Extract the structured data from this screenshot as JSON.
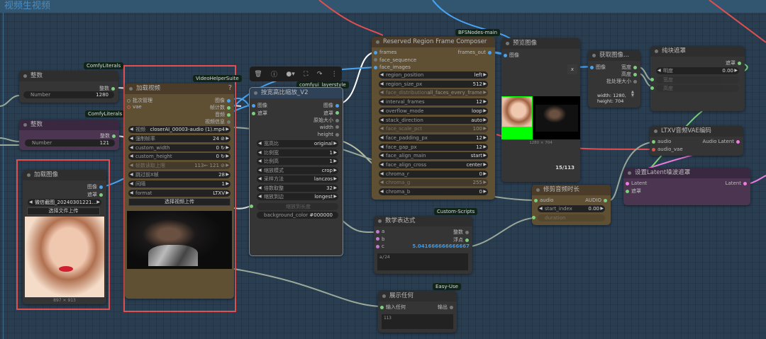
{
  "group_title": "视频生视频",
  "colors": {
    "canvas": "#2a3e52",
    "node": "#353535",
    "video_node": "#5f4f33",
    "purple_node": "#4b3550",
    "highlight": "#e05050"
  },
  "int1": {
    "tag": "ComfyLiterals",
    "title": "整数",
    "output": "整数",
    "widget_label": "Number",
    "widget_value": "1280"
  },
  "int2": {
    "tag": "ComfyLiterals",
    "title": "整数",
    "output": "整数",
    "widget_label": "Number",
    "widget_value": "121"
  },
  "load_image": {
    "title": "加载图像",
    "outputs": [
      "图像",
      "遮罩"
    ],
    "file": "微信截图_20240301221...",
    "upload": "选择文件上传",
    "size": "897 × 913"
  },
  "load_video": {
    "tag": "VideoHelperSuite",
    "title": "加载视频",
    "help": "?",
    "inputs": [
      "批次管理",
      "vae"
    ],
    "outputs": [
      "图像",
      "帧计数",
      "音频",
      "视频信息"
    ],
    "widgets": [
      {
        "l": "视频",
        "v": "closerAI_00003-audio (1).mp4"
      },
      {
        "l": "强制帧率",
        "v": "24 ⊘"
      },
      {
        "l": "custom_width",
        "v": "0 ↻"
      },
      {
        "l": "custom_height",
        "v": "0 ↻"
      },
      {
        "l": "帧数读取上限",
        "v": "113←  121 ⊘"
      },
      {
        "l": "跳过前X帧",
        "v": "28"
      },
      {
        "l": "间隔",
        "v": "1"
      },
      {
        "l": "format",
        "v": "LTXV"
      }
    ],
    "upload": "选择视频上传"
  },
  "toolbar": {
    "icons": [
      "trash-icon",
      "info-icon",
      "color-icon",
      "fit-icon",
      "bypass-icon",
      "more-icon"
    ]
  },
  "scale": {
    "tag": "comfyui_layerstyle",
    "title": "按宽高比缩放_V2",
    "inputs": [
      "图像",
      "遮罩"
    ],
    "outputs": [
      "图像",
      "遮罩",
      "原始大小",
      "width",
      "height"
    ],
    "widgets": [
      {
        "l": "宽高比",
        "v": "original"
      },
      {
        "l": "比例宽",
        "v": "1"
      },
      {
        "l": "比例高",
        "v": "1"
      },
      {
        "l": "缩放模式",
        "v": "crop"
      },
      {
        "l": "采样方法",
        "v": "lanczos"
      },
      {
        "l": "倍数取整",
        "v": "32"
      },
      {
        "l": "缩放到边",
        "v": "longest"
      }
    ],
    "to_length": "缩放到长度",
    "bg_label": "background_color",
    "bg_value": "#000000"
  },
  "composer": {
    "tag": "BFSNodes-main",
    "title": "Reserved Region Frame Composer",
    "inputs": [
      "frames",
      "face_sequence",
      "face_images"
    ],
    "output": "frames_out",
    "widgets": [
      {
        "l": "region_position",
        "v": "left"
      },
      {
        "l": "region_size_px",
        "v": "512"
      },
      {
        "l": "face_distribution",
        "v": "all_faces_every_frame"
      },
      {
        "l": "interval_frames",
        "v": "12"
      },
      {
        "l": "overflow_mode",
        "v": "loop"
      },
      {
        "l": "stack_direction",
        "v": "auto"
      },
      {
        "l": "face_scale_pct",
        "v": "100"
      },
      {
        "l": "face_padding_px",
        "v": "12"
      },
      {
        "l": "face_gap_px",
        "v": "12"
      },
      {
        "l": "face_align_main",
        "v": "start"
      },
      {
        "l": "face_align_cross",
        "v": "center"
      },
      {
        "l": "chroma_r",
        "v": "0"
      },
      {
        "l": "chroma_g",
        "v": "255"
      },
      {
        "l": "chroma_b",
        "v": "0"
      }
    ]
  },
  "preview": {
    "title": "预览图像",
    "input": "图像",
    "close": "x",
    "size": "1280 × 704",
    "counter": "15/113"
  },
  "get_size": {
    "title": "获取图像...",
    "input": "图像",
    "outputs": [
      "宽度",
      "高度",
      "批处理大小"
    ],
    "info": "width: 1280,\nheight: 704"
  },
  "solid_mask": {
    "title": "纯块遮罩",
    "output": "遮罩",
    "w_label": "明度",
    "w_value": "0.00",
    "inputs": [
      "宽度",
      "高度"
    ]
  },
  "ltxv": {
    "title": "LTXV音频VAE编码",
    "inputs": [
      "audio",
      "audio_vae"
    ],
    "output": "Audio Latent"
  },
  "set_latent": {
    "title": "设置Latent噪波遮罩",
    "inputs": [
      "Latent",
      "遮罩"
    ],
    "output": "Latent"
  },
  "trim": {
    "title": "修剪音频时长",
    "input": "audio",
    "output": "AUDIO",
    "w_label": "start_index",
    "w_value": "0.00",
    "duration": "duration"
  },
  "math": {
    "tag": "Custom-Scripts",
    "title": "数学表达式",
    "inputs": [
      "a",
      "b",
      "c"
    ],
    "outputs": [
      "整数",
      "浮点"
    ],
    "result": "5.041666666666667",
    "expr": "a/24"
  },
  "show": {
    "tag": "Easy-Use",
    "title": "展示任何",
    "input": "输入任何",
    "output": "输出",
    "text": "113"
  }
}
